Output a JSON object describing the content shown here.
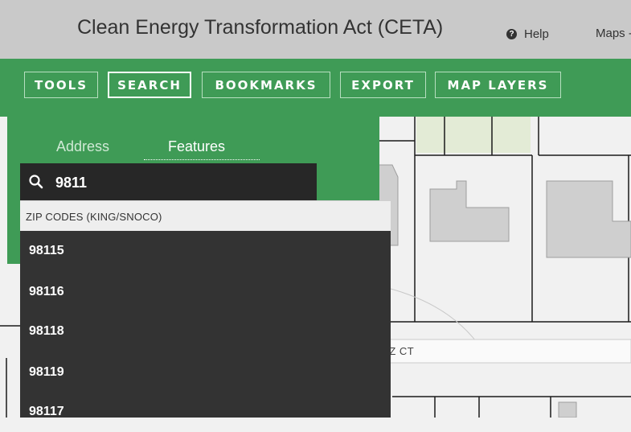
{
  "header": {
    "title": "Clean Energy Transformation Act (CETA)",
    "help_label": "Help",
    "maps_label": "Maps -"
  },
  "toolbar": {
    "buttons": [
      {
        "label": "TOOLS",
        "active": false
      },
      {
        "label": "SEARCH",
        "active": true
      },
      {
        "label": "BOOKMARKS",
        "active": false
      },
      {
        "label": "EXPORT",
        "active": false
      },
      {
        "label": "MAP LAYERS",
        "active": false
      }
    ]
  },
  "search_panel": {
    "tabs": [
      {
        "label": "Address",
        "selected": false
      },
      {
        "label": "Features",
        "selected": true
      }
    ],
    "query": "9811",
    "dropdown": {
      "group_header": "ZIP CODES (KING/SNOCO)",
      "results": [
        "98115",
        "98116",
        "98118",
        "98119",
        "98117"
      ]
    }
  },
  "map": {
    "street_label": "NIESZ CT"
  },
  "colors": {
    "header_bg": "#c9c9c9",
    "toolbar_green": "#3f9b56",
    "dropdown_bg": "#333333",
    "search_bg": "#272727"
  },
  "icons": [
    "help-icon",
    "search-icon"
  ]
}
